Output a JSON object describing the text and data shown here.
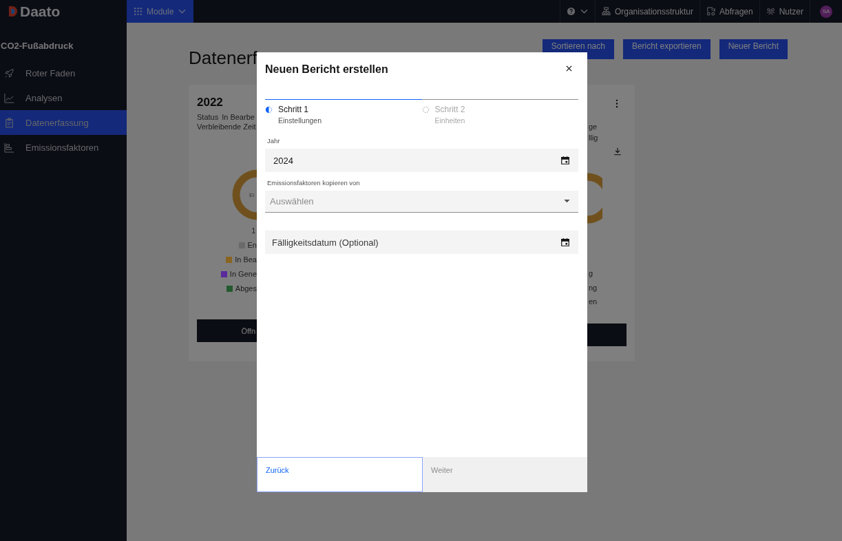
{
  "top_bar": {
    "logo": "Daato",
    "module_menu": {
      "label": "Module",
      "selected": true
    },
    "actions": [
      {
        "kind": "help"
      },
      {
        "kind": "org",
        "label": "Organisationsstruktur"
      },
      {
        "kind": "queries",
        "label": "Abfragen"
      },
      {
        "kind": "users",
        "label": "Nutzer"
      },
      {
        "kind": "avatar",
        "label": "SA"
      }
    ]
  },
  "sidebar": {
    "title": "CO2-Fußabdruck",
    "items": [
      {
        "label": "Roter Faden",
        "selected": false
      },
      {
        "label": "Analysen",
        "selected": false
      },
      {
        "label": "Datenerfassung",
        "selected": true
      },
      {
        "label": "Emissionsfaktoren",
        "selected": false
      }
    ]
  },
  "page": {
    "title": "Datenerf",
    "buttons": [
      "Sortieren nach",
      "Bericht exportieren",
      "Neuer Bericht"
    ]
  },
  "card": {
    "year": "2022",
    "status_label": "Status",
    "status_value": "In Bearbe",
    "remaining": "Verbleibende Zeit",
    "donut_center": "Ei",
    "donut_footer": "1",
    "legend": [
      {
        "label": "En",
        "color": "#6a6a6a"
      },
      {
        "label": "In Bea",
        "color": "#8a6420"
      },
      {
        "label": "In Gene",
        "color": "#5a2a9c"
      },
      {
        "label": "Abges",
        "color": "#235a2e"
      }
    ],
    "open_button": "Öffn",
    "right_lines": [
      "ge",
      "llig"
    ],
    "right_legend": [
      "g",
      "ng",
      "en"
    ]
  },
  "modal": {
    "title": "Neuen Bericht erstellen",
    "steps": [
      {
        "title": "Schritt 1",
        "subtitle": "Einstellungen",
        "selected": true
      },
      {
        "title": "Schritt 2",
        "subtitle": "Einheiten",
        "selected": false
      }
    ],
    "fields": [
      {
        "kind": "date",
        "label": "Jahr",
        "value": "2024"
      },
      {
        "kind": "select",
        "label": "Emissionsfaktoren kopieren von",
        "placeholder": "Auswählen"
      },
      {
        "kind": "date",
        "placeholder": "Fälligkeitsdatum (Optional)"
      }
    ],
    "footer_buttons": [
      {
        "label": "Zurück",
        "disabled": false
      },
      {
        "label": "Weiter",
        "disabled": true
      }
    ]
  }
}
